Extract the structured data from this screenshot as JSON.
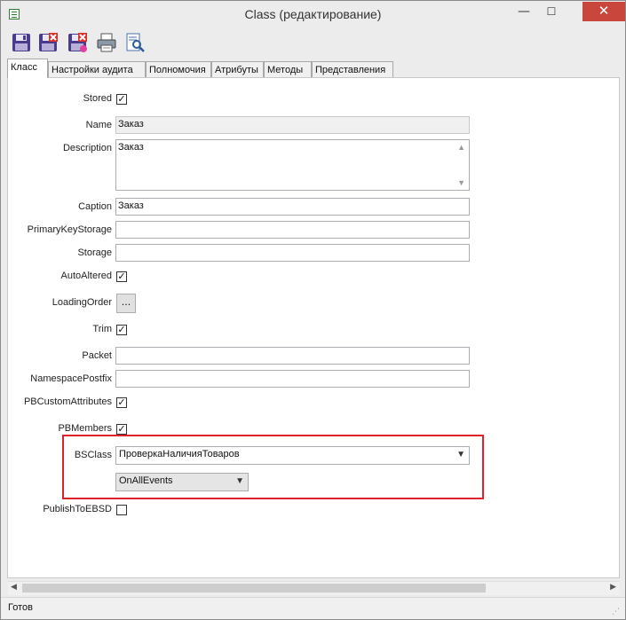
{
  "window": {
    "title": "Class (редактирование)",
    "minimize_glyph": "—",
    "maximize_glyph": "☐",
    "close_glyph": "✕"
  },
  "toolbar": {
    "icons": [
      "save-icon",
      "save-close-icon",
      "save-delete-icon",
      "print-icon",
      "preview-icon"
    ]
  },
  "tabs": [
    "Класс",
    "Настройки аудита",
    "Полномочия",
    "Атрибуты",
    "Методы",
    "Представления"
  ],
  "active_tab": "Класс",
  "form": {
    "stored": {
      "label": "Stored",
      "checked": true
    },
    "name": {
      "label": "Name",
      "value": "Заказ"
    },
    "description": {
      "label": "Description",
      "value": "Заказ"
    },
    "caption": {
      "label": "Caption",
      "value": "Заказ"
    },
    "primary_key_storage": {
      "label": "PrimaryKeyStorage",
      "value": ""
    },
    "storage": {
      "label": "Storage",
      "value": ""
    },
    "auto_altered": {
      "label": "AutoAltered",
      "checked": true
    },
    "loading_order": {
      "label": "LoadingOrder",
      "button": "..."
    },
    "trim": {
      "label": "Trim",
      "checked": true
    },
    "packet": {
      "label": "Packet",
      "value": ""
    },
    "namespace_postfix": {
      "label": "NamespacePostfix",
      "value": ""
    },
    "pb_custom_attributes": {
      "label": "PBCustomAttributes",
      "checked": true
    },
    "pb_members": {
      "label": "PBMembers",
      "checked": true
    },
    "bs_class": {
      "label": "BSClass",
      "value": "ПроверкаНаличияТоваров",
      "event": "OnAllEvents"
    },
    "publish_to_ebsd": {
      "label": "PublishToEBSD",
      "checked": false
    }
  },
  "highlight_color": "#e0202a",
  "status": {
    "text": "Готов"
  }
}
